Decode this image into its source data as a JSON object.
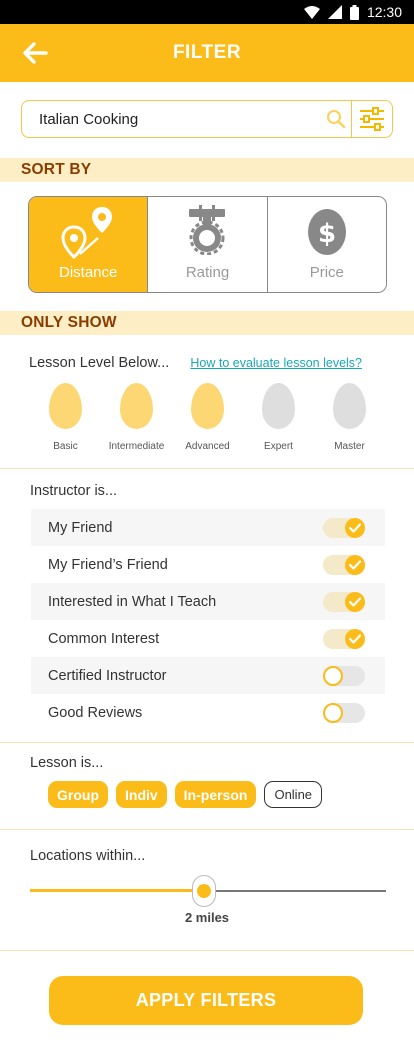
{
  "status_bar": {
    "time": "12:30"
  },
  "header": {
    "title": "FILTER"
  },
  "search": {
    "value": "Italian Cooking",
    "placeholder": ""
  },
  "sort_by": {
    "heading": "SORT BY",
    "options": [
      {
        "label": "Distance",
        "icon": "map-pin-route-icon",
        "selected": true
      },
      {
        "label": "Rating",
        "icon": "medal-icon",
        "selected": false
      },
      {
        "label": "Price",
        "icon": "dollar-egg-icon",
        "selected": false
      }
    ]
  },
  "only_show": {
    "heading": "ONLY SHOW",
    "level": {
      "label": "Lesson Level Below...",
      "help_link": "How to evaluate lesson levels?",
      "levels": [
        {
          "label": "Basic",
          "selected": true
        },
        {
          "label": "Intermediate",
          "selected": true
        },
        {
          "label": "Advanced",
          "selected": true
        },
        {
          "label": "Expert",
          "selected": false
        },
        {
          "label": "Master",
          "selected": false
        }
      ]
    },
    "instructor": {
      "label": "Instructor is...",
      "items": [
        {
          "label": "My Friend",
          "on": true
        },
        {
          "label": "My Friend’s Friend",
          "on": true
        },
        {
          "label": "Interested in What I Teach",
          "on": true
        },
        {
          "label": "Common Interest",
          "on": true
        },
        {
          "label": "Certified Instructor",
          "on": false
        },
        {
          "label": "Good Reviews",
          "on": false
        }
      ]
    },
    "lesson": {
      "label": "Lesson is...",
      "types": [
        {
          "label": "Group",
          "on": true
        },
        {
          "label": "Indiv",
          "on": true
        },
        {
          "label": "In-person",
          "on": true
        },
        {
          "label": "Online",
          "on": false
        }
      ]
    },
    "location": {
      "label": "Locations within...",
      "value_label": "2 miles",
      "fraction": 0.49
    }
  },
  "apply": {
    "label": "APPLY FILTERS"
  },
  "colors": {
    "accent": "#fbbc1a",
    "section_bg": "#fdeec6",
    "section_text": "#8a3c00",
    "link": "#1aa7b4"
  }
}
